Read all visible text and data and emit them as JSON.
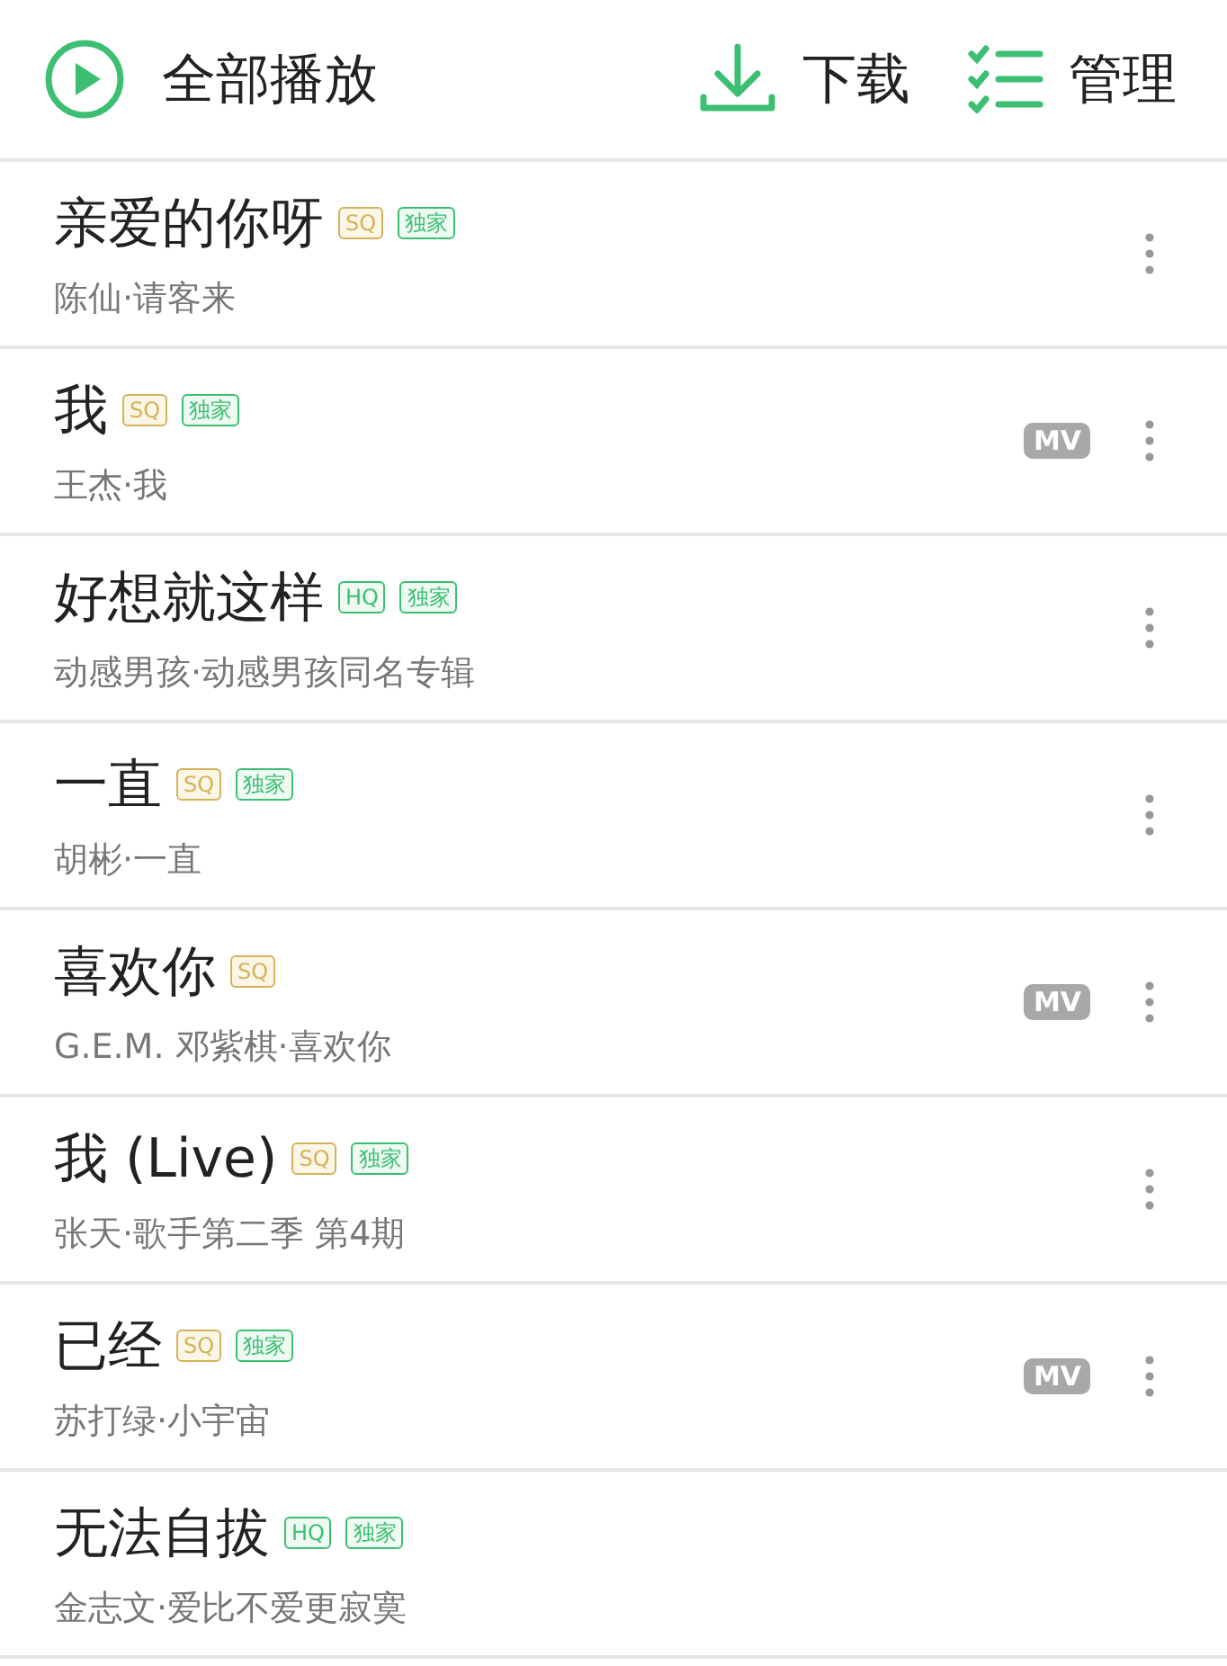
{
  "header": {
    "play_all": "全部播放",
    "download": "下载",
    "manage": "管理"
  },
  "songs": [
    {
      "title": "亲爱的你呀",
      "tags": [
        {
          "kind": "sq",
          "text": "SQ"
        },
        {
          "kind": "exclusive",
          "text": "独家"
        }
      ],
      "subtitle": "陈仙·请客来",
      "menu": true
    },
    {
      "title": "我",
      "tags": [
        {
          "kind": "sq",
          "text": "SQ"
        },
        {
          "kind": "exclusive",
          "text": "独家"
        }
      ],
      "subtitle": "王杰·我",
      "mv": "MV",
      "menu": true
    },
    {
      "title": "好想就这样",
      "tags": [
        {
          "kind": "hq",
          "text": "HQ"
        },
        {
          "kind": "exclusive",
          "text": "独家"
        }
      ],
      "subtitle": "动感男孩·动感男孩同名专辑",
      "menu": true
    },
    {
      "title": "一直",
      "tags": [
        {
          "kind": "sq",
          "text": "SQ"
        },
        {
          "kind": "exclusive",
          "text": "独家"
        }
      ],
      "subtitle": "胡彬·一直",
      "menu": true
    },
    {
      "title": "喜欢你",
      "tags": [
        {
          "kind": "sq",
          "text": "SQ"
        }
      ],
      "subtitle": "G.E.M. 邓紫棋·喜欢你",
      "mv": "MV",
      "menu": true
    },
    {
      "title": "我 (Live)",
      "tags": [
        {
          "kind": "sq",
          "text": "SQ"
        },
        {
          "kind": "exclusive",
          "text": "独家"
        }
      ],
      "subtitle": "张天·歌手第二季 第4期",
      "menu": true
    },
    {
      "title": "已经",
      "tags": [
        {
          "kind": "sq",
          "text": "SQ"
        },
        {
          "kind": "exclusive",
          "text": "独家"
        }
      ],
      "subtitle": "苏打绿·小宇宙",
      "mv": "MV",
      "menu": true
    },
    {
      "title": "无法自拔",
      "tags": [
        {
          "kind": "hq",
          "text": "HQ"
        },
        {
          "kind": "exclusive",
          "text": "独家"
        }
      ],
      "subtitle": "金志文·爱比不爱更寂寞",
      "menu": false
    }
  ]
}
